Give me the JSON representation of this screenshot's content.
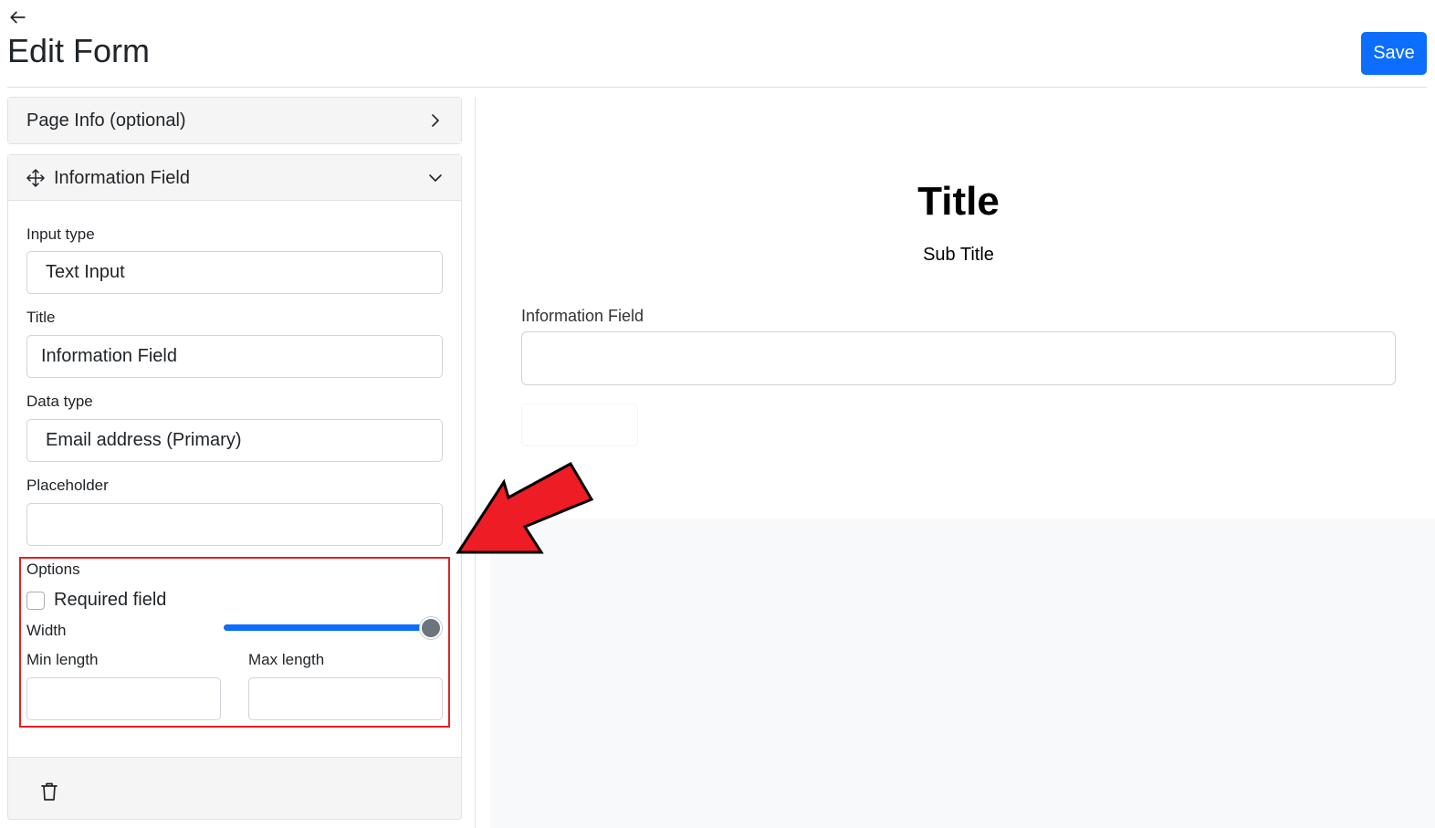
{
  "header": {
    "back_icon": "arrow-left-icon",
    "title": "Edit Form",
    "save_label": "Save"
  },
  "sidebar": {
    "page_info": {
      "label": "Page Info (optional)",
      "icon": "chevron-right-icon"
    },
    "field_section": {
      "label": "Information Field",
      "icons": [
        "move-icon",
        "chevron-down-icon"
      ],
      "input_type": {
        "label": "Input type",
        "value": "Text Input"
      },
      "title": {
        "label": "Title",
        "value": "Information Field"
      },
      "data_type": {
        "label": "Data type",
        "value": "Email address (Primary)"
      },
      "placeholder": {
        "label": "Placeholder",
        "value": ""
      },
      "options": {
        "label": "Options",
        "required_label": "Required field",
        "required_checked": false,
        "width_label": "Width",
        "width_value": 1.0,
        "min_length_label": "Min length",
        "max_length_label": "Max length"
      },
      "footer_icon": "trash-icon"
    }
  },
  "preview": {
    "title": "Title",
    "subtitle": "Sub Title",
    "field_label": "Information Field"
  },
  "colors": {
    "primary": "#0d6efd",
    "highlight_box": "#e32222",
    "annotation_arrow": "#ee1c25"
  }
}
